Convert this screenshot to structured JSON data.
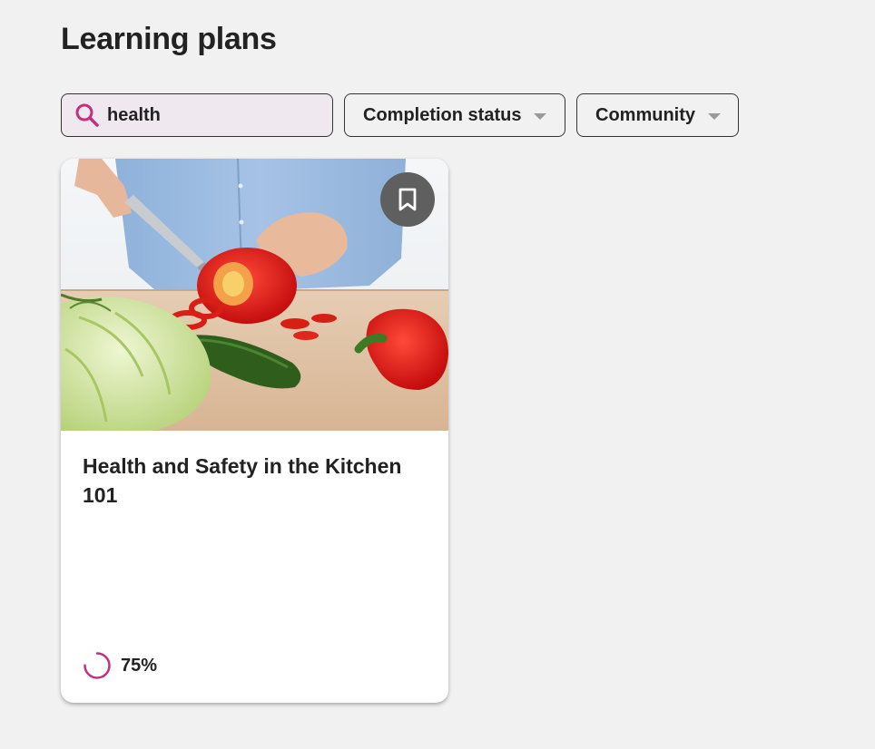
{
  "page": {
    "title": "Learning plans"
  },
  "filters": {
    "search": {
      "value": "health",
      "icon": "search-icon",
      "clear_icon": "close-icon"
    },
    "completion_status": {
      "label": "Completion status",
      "icon": "caret-down-icon"
    },
    "community": {
      "label": "Community",
      "icon": "caret-down-icon"
    }
  },
  "cards": [
    {
      "title": "Health and Safety in the Kitchen 101",
      "progress": 0.75,
      "progress_label": "75%",
      "bookmark_icon": "bookmark-icon"
    }
  ],
  "colors": {
    "accent": "#c2307e",
    "clear_icon": "#3c4f8a",
    "background": "#f1f1f1",
    "bookmark_bg": "#5f5f5f"
  }
}
